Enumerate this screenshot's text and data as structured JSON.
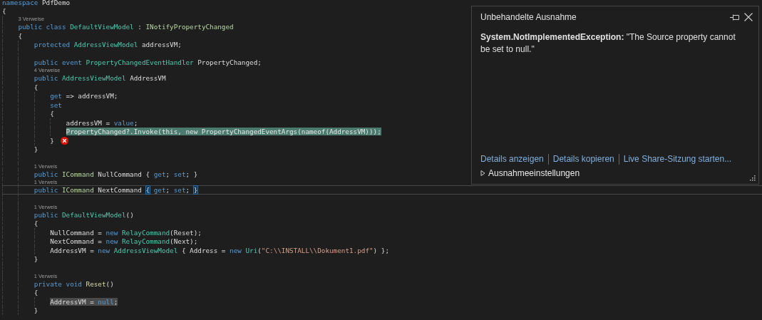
{
  "editor": {
    "lines": [
      {
        "kind": "code",
        "tokens": [
          {
            "kind": "kw",
            "text": "namespace "
          },
          {
            "kind": "plain",
            "text": "PdfDemo"
          }
        ]
      },
      {
        "kind": "code",
        "tokens": [
          {
            "kind": "plain",
            "text": "{"
          }
        ],
        "children": [
          {
            "kind": "code",
            "codelens": "3 Verweise",
            "tokens": [
              {
                "kind": "kw",
                "text": "public class "
              },
              {
                "kind": "type",
                "text": "DefaultViewModel"
              },
              {
                "kind": "plain",
                "text": " : "
              },
              {
                "kind": "iface",
                "text": "INotifyPropertyChanged"
              }
            ]
          },
          {
            "kind": "code",
            "tokens": [
              {
                "kind": "plain",
                "text": "{"
              }
            ],
            "children": [
              {
                "kind": "code",
                "tokens": [
                  {
                    "kind": "kw",
                    "text": "protected "
                  },
                  {
                    "kind": "type",
                    "text": "AddressViewModel"
                  },
                  {
                    "kind": "plain",
                    "text": " addressVM;"
                  }
                ]
              },
              {
                "kind": "blank"
              },
              {
                "kind": "code",
                "tokens": [
                  {
                    "kind": "kw",
                    "text": "public event "
                  },
                  {
                    "kind": "type",
                    "text": "PropertyChangedEventHandler"
                  },
                  {
                    "kind": "plain",
                    "text": " PropertyChanged;"
                  }
                ]
              },
              {
                "kind": "code",
                "codelens": "4 Verweise",
                "tokens": [
                  {
                    "kind": "kw",
                    "text": "public "
                  },
                  {
                    "kind": "type",
                    "text": "AddressViewModel"
                  },
                  {
                    "kind": "plain",
                    "text": " AddressVM"
                  }
                ]
              },
              {
                "kind": "code",
                "tokens": [
                  {
                    "kind": "plain",
                    "text": "{"
                  }
                ],
                "children": [
                  {
                    "kind": "code",
                    "tokens": [
                      {
                        "kind": "kw",
                        "text": "get"
                      },
                      {
                        "kind": "plain",
                        "text": " => addressVM;"
                      }
                    ]
                  },
                  {
                    "kind": "code",
                    "tokens": [
                      {
                        "kind": "kw",
                        "text": "set"
                      }
                    ]
                  },
                  {
                    "kind": "code",
                    "tokens": [
                      {
                        "kind": "plain",
                        "text": "{"
                      }
                    ],
                    "children": [
                      {
                        "kind": "code",
                        "tokens": [
                          {
                            "kind": "plain",
                            "text": "addressVM = "
                          },
                          {
                            "kind": "kw",
                            "text": "value"
                          },
                          {
                            "kind": "plain",
                            "text": ";"
                          }
                        ]
                      },
                      {
                        "kind": "code",
                        "current_statement": true,
                        "tokens": [
                          {
                            "kind": "plain",
                            "text": "PropertyChanged?.Invoke(this, new PropertyChangedEventArgs(nameof(AddressVM)));"
                          }
                        ]
                      }
                    ]
                  },
                  {
                    "kind": "code",
                    "error": true,
                    "tokens": [
                      {
                        "kind": "plain",
                        "text": "}"
                      }
                    ]
                  }
                ]
              },
              {
                "kind": "code",
                "tokens": [
                  {
                    "kind": "plain",
                    "text": "}"
                  }
                ]
              },
              {
                "kind": "blank"
              },
              {
                "kind": "code",
                "codelens": "1 Verweis",
                "tokens": [
                  {
                    "kind": "kw",
                    "text": "public "
                  },
                  {
                    "kind": "iface",
                    "text": "ICommand"
                  },
                  {
                    "kind": "plain",
                    "text": " NullCommand { "
                  },
                  {
                    "kind": "kw",
                    "text": "get"
                  },
                  {
                    "kind": "plain",
                    "text": "; "
                  },
                  {
                    "kind": "kw",
                    "text": "set"
                  },
                  {
                    "kind": "plain",
                    "text": "; }"
                  }
                ]
              },
              {
                "kind": "code",
                "codelens": "1 Verweis",
                "current": true,
                "tokens": [
                  {
                    "kind": "kw",
                    "text": "public "
                  },
                  {
                    "kind": "iface",
                    "text": "ICommand"
                  },
                  {
                    "kind": "plain",
                    "text": " NextCommand "
                  },
                  {
                    "kind": "brace-match",
                    "text": "{"
                  },
                  {
                    "kind": "kw",
                    "text": " get"
                  },
                  {
                    "kind": "plain",
                    "text": "; "
                  },
                  {
                    "kind": "kw",
                    "text": "set"
                  },
                  {
                    "kind": "plain",
                    "text": "; "
                  },
                  {
                    "kind": "brace-match",
                    "text": "}"
                  }
                ]
              },
              {
                "kind": "blank"
              },
              {
                "kind": "code",
                "codelens": "1 Verweis",
                "tokens": [
                  {
                    "kind": "kw",
                    "text": "public "
                  },
                  {
                    "kind": "type",
                    "text": "DefaultViewModel"
                  },
                  {
                    "kind": "plain",
                    "text": "()"
                  }
                ]
              },
              {
                "kind": "code",
                "tokens": [
                  {
                    "kind": "plain",
                    "text": "{"
                  }
                ],
                "children": [
                  {
                    "kind": "code",
                    "tokens": [
                      {
                        "kind": "plain",
                        "text": "NullCommand = "
                      },
                      {
                        "kind": "kw",
                        "text": "new "
                      },
                      {
                        "kind": "type",
                        "text": "RelayCommand"
                      },
                      {
                        "kind": "plain",
                        "text": "(Reset);"
                      }
                    ]
                  },
                  {
                    "kind": "code",
                    "tokens": [
                      {
                        "kind": "plain",
                        "text": "NextCommand = "
                      },
                      {
                        "kind": "kw",
                        "text": "new "
                      },
                      {
                        "kind": "type",
                        "text": "RelayCommand"
                      },
                      {
                        "kind": "plain",
                        "text": "(Next);"
                      }
                    ]
                  },
                  {
                    "kind": "code",
                    "tokens": [
                      {
                        "kind": "plain",
                        "text": "AddressVM = "
                      },
                      {
                        "kind": "kw",
                        "text": "new "
                      },
                      {
                        "kind": "type",
                        "text": "AddressViewModel"
                      },
                      {
                        "kind": "plain",
                        "text": " { Address = "
                      },
                      {
                        "kind": "kw",
                        "text": "new "
                      },
                      {
                        "kind": "type",
                        "text": "Uri"
                      },
                      {
                        "kind": "plain",
                        "text": "("
                      },
                      {
                        "kind": "str",
                        "text": "\"C:\\\\INSTALL\\\\Dokument1.pdf\""
                      },
                      {
                        "kind": "plain",
                        "text": ") };"
                      }
                    ]
                  }
                ]
              },
              {
                "kind": "code",
                "tokens": [
                  {
                    "kind": "plain",
                    "text": "}"
                  }
                ]
              },
              {
                "kind": "blank"
              },
              {
                "kind": "code",
                "codelens": "1 Verweis",
                "tokens": [
                  {
                    "kind": "kw",
                    "text": "private void "
                  },
                  {
                    "kind": "method",
                    "text": "Reset"
                  },
                  {
                    "kind": "plain",
                    "text": "()"
                  }
                ]
              },
              {
                "kind": "code",
                "tokens": [
                  {
                    "kind": "plain",
                    "text": "{"
                  }
                ],
                "children": [
                  {
                    "kind": "code",
                    "reference_highlight": true,
                    "tokens": [
                      {
                        "kind": "plain",
                        "text": "AddressVM = "
                      },
                      {
                        "kind": "kw",
                        "text": "null"
                      },
                      {
                        "kind": "plain",
                        "text": ";"
                      }
                    ]
                  }
                ]
              },
              {
                "kind": "code",
                "tokens": [
                  {
                    "kind": "plain",
                    "text": "}"
                  }
                ]
              }
            ]
          }
        ]
      }
    ]
  },
  "exception_popup": {
    "title": "Unbehandelte Ausnahme",
    "message": "**System.NotImplementedException:** \"The Source property cannot be set to null.\"",
    "links": [
      "Details anzeigen",
      "Details kopieren",
      "Live Share-Sitzung starten..."
    ],
    "settings": {
      "label": "Ausnahmeeinstellungen",
      "expanded": false
    }
  }
}
